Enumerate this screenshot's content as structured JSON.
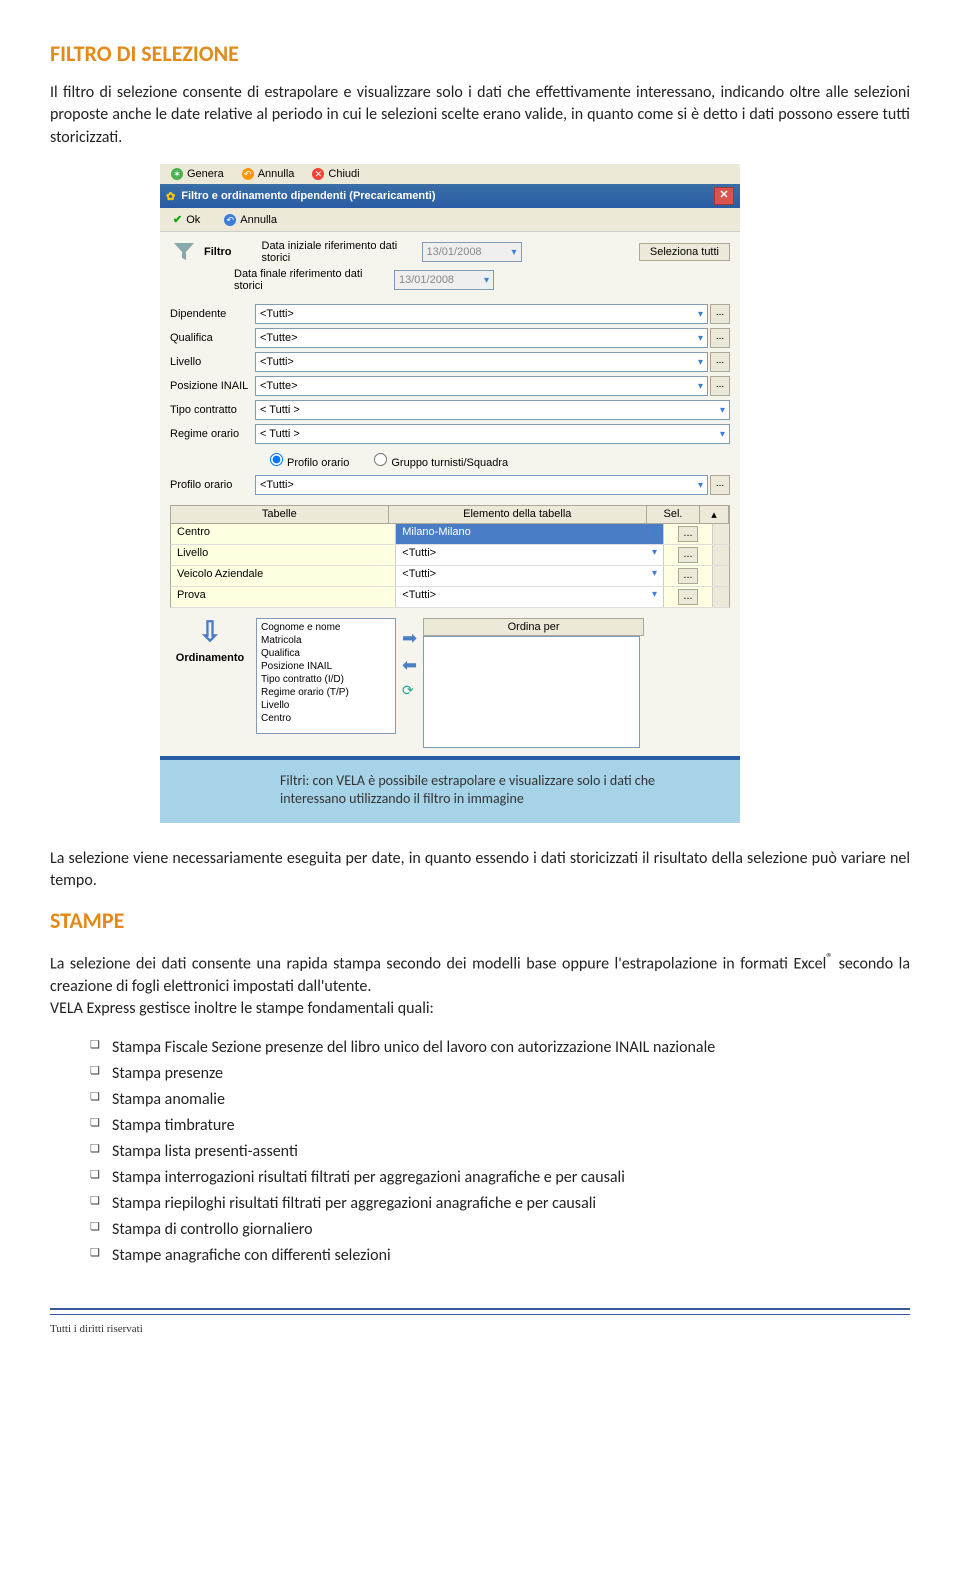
{
  "heading1": "FILTRO DI SELEZIONE",
  "intro1": "Il filtro di selezione consente di estrapolare e visualizzare solo i dati che effettivamente interessano, indicando oltre alle selezioni proposte anche le date relative al periodo in cui le selezioni scelte erano valide, in quanto come si è detto i dati possono essere tutti storicizzati.",
  "win": {
    "top": {
      "genera": "Genera",
      "annulla": "Annulla",
      "chiudi": "Chiudi"
    },
    "title": "Filtro e ordinamento dipendenti (Precaricamenti)",
    "sub": {
      "ok": "Ok",
      "annulla": "Annulla"
    },
    "filtro_label": "Filtro",
    "date1_label": "Data iniziale riferimento dati storici",
    "date2_label": "Data finale riferimento dati storici",
    "date1_val": "13/01/2008",
    "date2_val": "13/01/2008",
    "sel_all": "Seleziona tutti",
    "rows": [
      {
        "label": "Dipendente",
        "val": "<Tutti>"
      },
      {
        "label": "Qualifica",
        "val": "<Tutte>"
      },
      {
        "label": "Livello",
        "val": "<Tutti>"
      },
      {
        "label": "Posizione INAIL",
        "val": "<Tutte>"
      },
      {
        "label": "Tipo contratto",
        "val": "< Tutti >"
      },
      {
        "label": "Regime orario",
        "val": "< Tutti >"
      }
    ],
    "radio1": "Profilo orario",
    "radio2": "Gruppo turnisti/Squadra",
    "profilo_label": "Profilo orario",
    "profilo_val": "<Tutti>",
    "thead": {
      "tab": "Tabelle",
      "elem": "Elemento della tabella",
      "sel": "Sel."
    },
    "trows": [
      {
        "tab": "Centro",
        "elem": "Milano-Milano",
        "hl": true
      },
      {
        "tab": "Livello",
        "elem": "<Tutti>",
        "hl": false
      },
      {
        "tab": "Veicolo Aziendale",
        "elem": "<Tutti>",
        "hl": false
      },
      {
        "tab": "Prova",
        "elem": "<Tutti>",
        "hl": false
      }
    ],
    "ord_label": "Ordinamento",
    "ord_head": "Ordina per",
    "ord_items": [
      "Cognome e nome",
      "Matricola",
      "Qualifica",
      "Posizione INAIL",
      "Tipo contratto (I/D)",
      "Regime orario (T/P)",
      "Livello",
      "Centro"
    ]
  },
  "caption": "Filtri: con VELA è possibile estrapolare e visualizzare solo i dati che interessano utilizzando il filtro in immagine",
  "para2": "La selezione viene necessariamente eseguita per date, in quanto essendo i dati storicizzati il risultato della selezione può variare nel tempo.",
  "heading2": "STAMPE",
  "para3a": "La selezione dei dati consente una rapida stampa secondo dei modelli base oppure l'estrapolazione in formati Excel",
  "para3b": " secondo la creazione di fogli elettronici impostati dall'utente.",
  "para3c": "VELA Express gestisce inoltre le stampe fondamentali quali:",
  "bullets": [
    "Stampa Fiscale Sezione presenze del libro unico del lavoro con autorizzazione INAIL nazionale",
    "Stampa presenze",
    " Stampa anomalie",
    "Stampa timbrature",
    "Stampa lista presenti-assenti",
    "Stampa interrogazioni risultati filtrati per aggregazioni anagrafiche e per causali",
    "Stampa riepiloghi risultati filtrati per aggregazioni anagrafiche e per causali",
    "Stampa di controllo giornaliero",
    "Stampe anagrafiche con differenti selezioni"
  ],
  "footer": "Tutti i diritti riservati"
}
